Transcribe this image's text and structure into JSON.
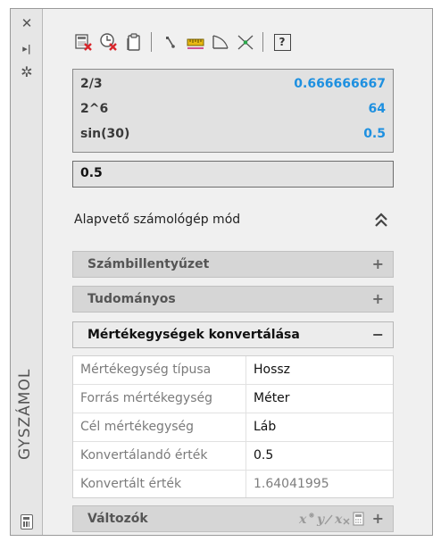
{
  "palette": {
    "title": "GYSZÁMOL"
  },
  "titlebar": {
    "close_glyph": "✕",
    "autohide_glyph": "▸|",
    "properties_glyph": "✲"
  },
  "toolbar": {
    "items": [
      {
        "icon": "clear-icon",
        "group": 1
      },
      {
        "icon": "clear-history-icon",
        "group": 1
      },
      {
        "icon": "paste-to-command-line-icon",
        "group": 1
      },
      {
        "icon": "get-coordinates-icon",
        "group": 2
      },
      {
        "icon": "distance-between-two-points-icon",
        "group": 2
      },
      {
        "icon": "angle-of-line-icon",
        "group": 2
      },
      {
        "icon": "intersection-of-four-points-icon",
        "group": 2
      },
      {
        "icon": "help-icon",
        "group": 3
      }
    ],
    "help_label": "?"
  },
  "history": [
    {
      "expr": "2/3",
      "value": "0.666666667"
    },
    {
      "expr": "2^6",
      "value": "64"
    },
    {
      "expr": "sin(30)",
      "value": "0.5"
    }
  ],
  "input": {
    "value": "0.5"
  },
  "mode": {
    "label": "Alapvető számológép mód"
  },
  "sections": {
    "numpad": {
      "label": "Számbillentyűzet",
      "sign": "+"
    },
    "scientific": {
      "label": "Tudományos",
      "sign": "+"
    },
    "units": {
      "label": "Mértékegységek konvertálása",
      "sign": "−"
    },
    "variables": {
      "label": "Változók",
      "sign": "+"
    }
  },
  "units_grid": {
    "rows": [
      {
        "key": "Mértékegység típusa",
        "value": "Hossz",
        "readonly": false
      },
      {
        "key": "Forrás mértékegység",
        "value": "Méter",
        "readonly": false
      },
      {
        "key": "Cél mértékegység",
        "value": "Láb",
        "readonly": false
      },
      {
        "key": "Konvertálandó érték",
        "value": "0.5",
        "readonly": false
      },
      {
        "key": "Konvertált érték",
        "value": "1.64041995",
        "readonly": true
      }
    ]
  },
  "colors": {
    "history_value": "#1e90e0",
    "red_badge": "#d9262b",
    "yellow": "#e8b814"
  }
}
